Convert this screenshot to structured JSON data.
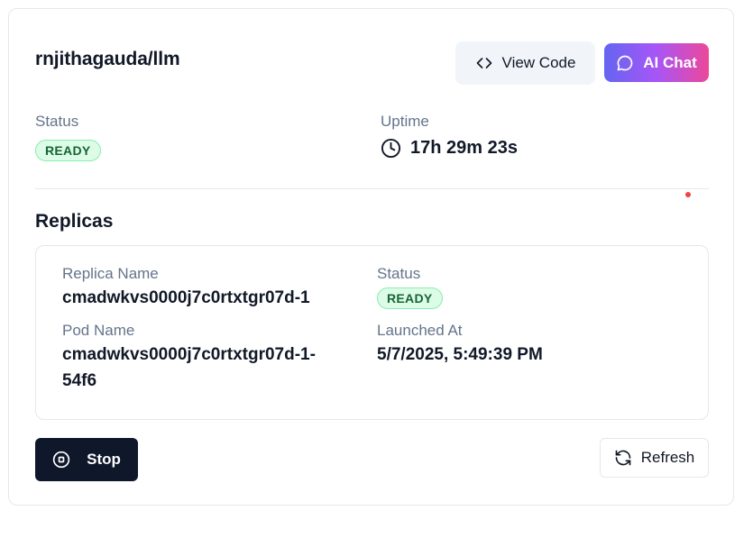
{
  "header": {
    "title": "rnjithagauda/llm",
    "view_code_label": "View Code",
    "ai_chat_label": "AI Chat"
  },
  "overview": {
    "status_label": "Status",
    "status_value": "READY",
    "uptime_label": "Uptime",
    "uptime_value": "17h 29m 23s"
  },
  "replicas": {
    "title": "Replicas",
    "items": [
      {
        "replica_name_label": "Replica Name",
        "replica_name": "cmadwkvs0000j7c0rtxtgr07d-1",
        "status_label": "Status",
        "status": "READY",
        "pod_name_label": "Pod Name",
        "pod_name_line1": "cmadwkvs0000j7c0rtxtgr07d-1-",
        "pod_name_line2": "54f6",
        "launched_at_label": "Launched At",
        "launched_at": "5/7/2025, 5:49:39 PM"
      }
    ]
  },
  "actions": {
    "stop_label": "Stop",
    "refresh_label": "Refresh"
  },
  "colors": {
    "primary_dark": "#0f172a",
    "ready_bg": "#dcfce7",
    "ready_text": "#166534",
    "gradient_start": "#6366f1",
    "gradient_end": "#ec4899"
  },
  "icons": {
    "view_code": "code-brackets-icon",
    "ai_chat": "chat-bubble-icon",
    "uptime": "clock-icon",
    "stop": "stop-circle-icon",
    "refresh": "refresh-icon"
  }
}
